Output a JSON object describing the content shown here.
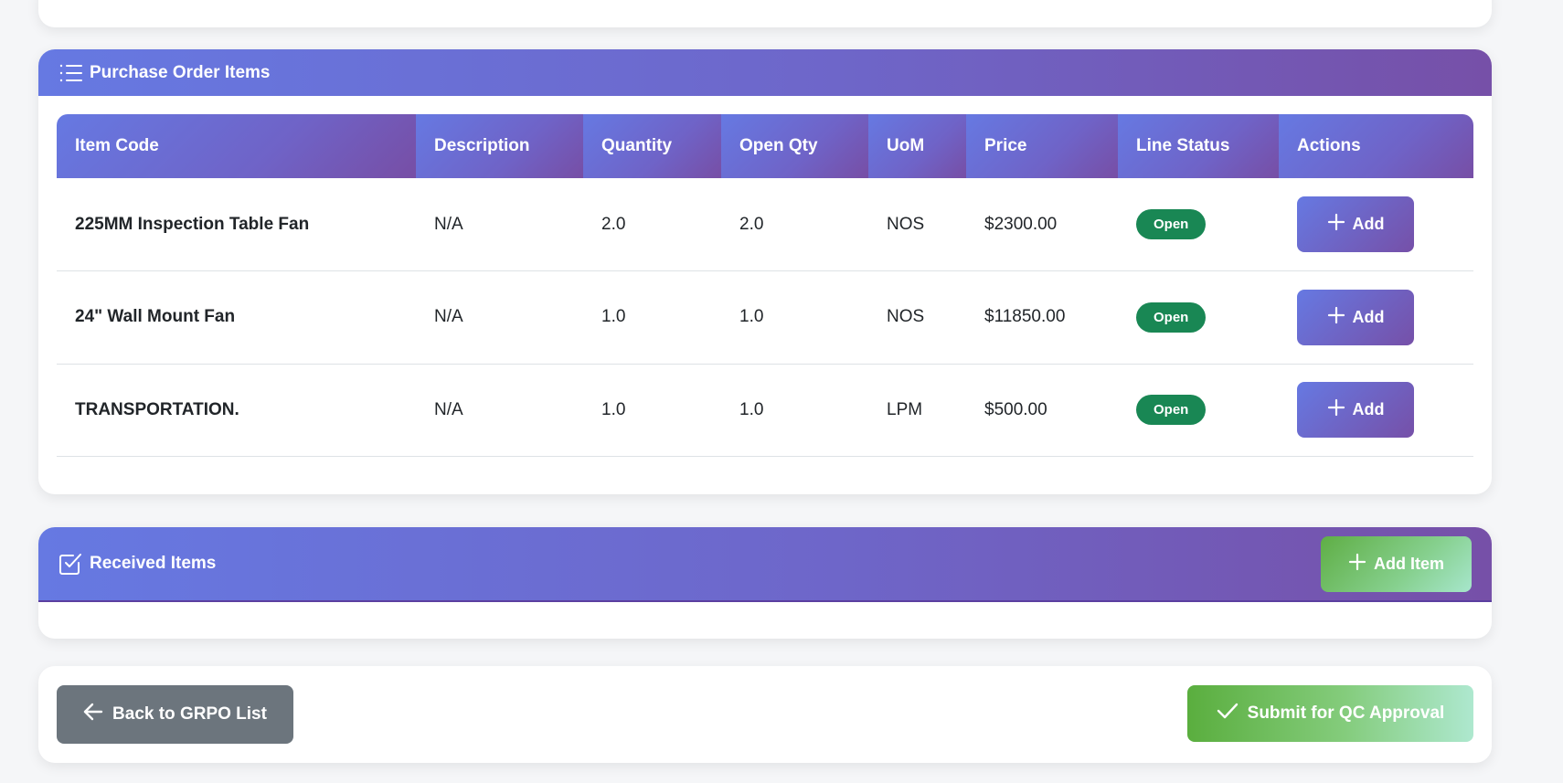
{
  "po_items": {
    "title": "Purchase Order Items",
    "icon": "list-icon",
    "columns": [
      "Item Code",
      "Description",
      "Quantity",
      "Open Qty",
      "UoM",
      "Price",
      "Line Status",
      "Actions"
    ],
    "rows": [
      {
        "item_code": "225MM Inspection Table Fan",
        "description": "N/A",
        "quantity": "2.0",
        "open_qty": "2.0",
        "uom": "NOS",
        "price": "$2300.00",
        "line_status": "Open",
        "action_label": "Add"
      },
      {
        "item_code": "24\" Wall Mount Fan",
        "description": "N/A",
        "quantity": "1.0",
        "open_qty": "1.0",
        "uom": "NOS",
        "price": "$11850.00",
        "line_status": "Open",
        "action_label": "Add"
      },
      {
        "item_code": "TRANSPORTATION.",
        "description": "N/A",
        "quantity": "1.0",
        "open_qty": "1.0",
        "uom": "LPM",
        "price": "$500.00",
        "line_status": "Open",
        "action_label": "Add"
      }
    ]
  },
  "received_items": {
    "title": "Received Items",
    "icon": "check-square-icon",
    "add_button_label": "Add Item"
  },
  "footer": {
    "back_label": "Back to GRPO List",
    "submit_label": "Submit for QC Approval"
  },
  "colors": {
    "header_gradient_start": "#6679e2",
    "header_gradient_end": "#7650a8",
    "status_open": "#198754",
    "back_button": "#6c757d",
    "submit_gradient_start": "#5aae3e",
    "submit_gradient_end": "#aee8cf"
  }
}
